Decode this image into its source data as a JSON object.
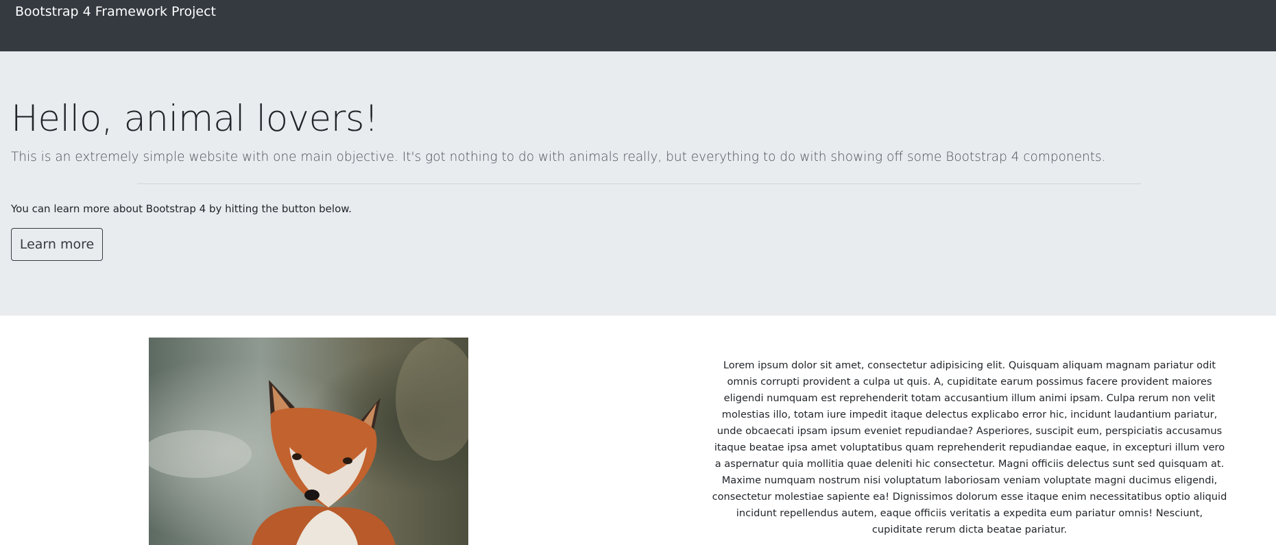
{
  "navbar": {
    "brand": "Bootstrap 4 Framework Project"
  },
  "jumbotron": {
    "heading": "Hello, animal lovers!",
    "lead": "This is an extremely simple website with one main objective. It's got nothing to do with animals really, but everything to do with showing off some Bootstrap 4 components.",
    "note": "You can learn more about Bootstrap 4 by hitting the button below.",
    "button_label": "Learn more"
  },
  "content": {
    "image_subject": "fox",
    "paragraph": "Lorem ipsum dolor sit amet, consectetur adipisicing elit. Quisquam aliquam magnam pariatur odit omnis corrupti provident a culpa ut quis. A, cupiditate earum possimus facere provident maiores eligendi numquam est reprehenderit totam accusantium illum animi ipsam. Culpa rerum non velit molestias illo, totam iure impedit itaque delectus explicabo error hic, incidunt laudantium pariatur, unde obcaecati ipsam ipsum eveniet repudiandae? Asperiores, suscipit eum, perspiciatis accusamus itaque beatae ipsa amet voluptatibus quam reprehenderit repudiandae eaque, in excepturi illum vero a aspernatur quia mollitia quae deleniti hic consectetur. Magni officiis delectus sunt sed quisquam at. Maxime numquam nostrum nisi voluptatum laboriosam veniam voluptate magni ducimus eligendi, consectetur molestiae sapiente ea! Dignissimos dolorum esse itaque enim necessitatibus optio aliquid incidunt repellendus autem, eaque officiis veritatis a expedita eum pariatur omnis! Nesciunt, cupiditate rerum dicta beatae pariatur."
  },
  "colors": {
    "navbar_bg": "#343a40",
    "jumbotron_bg": "#e9ecef",
    "text": "#212529"
  }
}
